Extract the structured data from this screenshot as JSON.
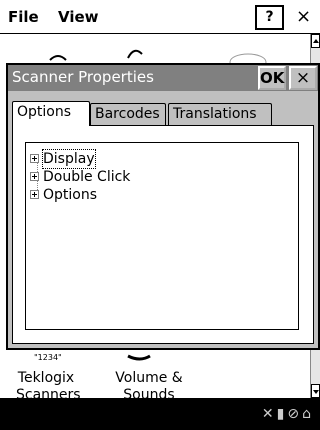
{
  "menubar": {
    "file_label": "File",
    "view_label": "View",
    "help_label": "?",
    "close_label": "×"
  },
  "background_icons": [
    {
      "label_line1": "Teklogix",
      "label_line2": "Scanners"
    },
    {
      "label_line1": "Volume &",
      "label_line2": "Sounds"
    }
  ],
  "dialog": {
    "title": "Scanner Properties",
    "ok_label": "OK",
    "close_label": "×",
    "tabs": [
      {
        "label": "Options",
        "active": true
      },
      {
        "label": "Barcodes",
        "active": false
      },
      {
        "label": "Translations",
        "active": false
      }
    ],
    "tree": [
      {
        "label": "Display",
        "expanded": false,
        "selected": true
      },
      {
        "label": "Double Click",
        "expanded": false,
        "selected": false
      },
      {
        "label": "Options",
        "expanded": false,
        "selected": false
      }
    ]
  },
  "taskbar": {
    "tray_icons": [
      "no-signal-icon",
      "battery-icon",
      "no-radio-icon",
      "network-icon"
    ]
  }
}
